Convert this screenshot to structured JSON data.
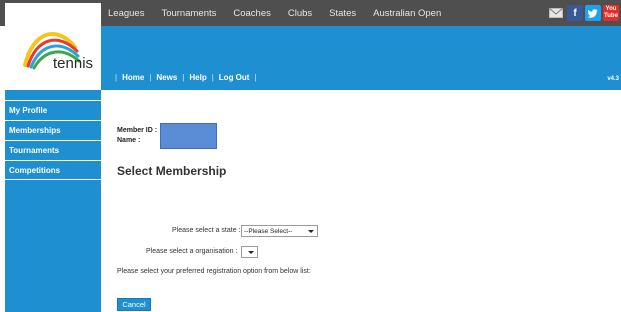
{
  "top_nav": {
    "items": [
      "Leagues",
      "Tournaments",
      "Coaches",
      "Clubs",
      "States",
      "Australian Open"
    ]
  },
  "social": {
    "icons": [
      "mail-icon",
      "facebook-icon",
      "twitter-icon",
      "youtube-icon"
    ],
    "colors": {
      "mail": "#4f4f4f",
      "facebook": "#3b5998",
      "twitter": "#1da1f2",
      "youtube": "#e52d27"
    }
  },
  "logo": {
    "text": "tennis"
  },
  "sub_nav": {
    "items": [
      "Home",
      "News",
      "Help",
      "Log Out"
    ],
    "version": "v4.3"
  },
  "sidebar": {
    "items": [
      "My Profile",
      "Memberships",
      "Tournaments",
      "Competitions"
    ]
  },
  "member": {
    "id_label": "Member ID :",
    "name_label": "Name :"
  },
  "page": {
    "title": "Select Membership",
    "state_label": "Please select a state :",
    "state_value": "--Please Select--",
    "org_label": "Please select a organisation :",
    "org_value": "",
    "registration_text": "Please select your preferred registration option from below list:",
    "cancel_label": "Cancel"
  },
  "colors": {
    "brand_blue": "#1e8fd1",
    "top_bar": "#4f4f4f"
  }
}
